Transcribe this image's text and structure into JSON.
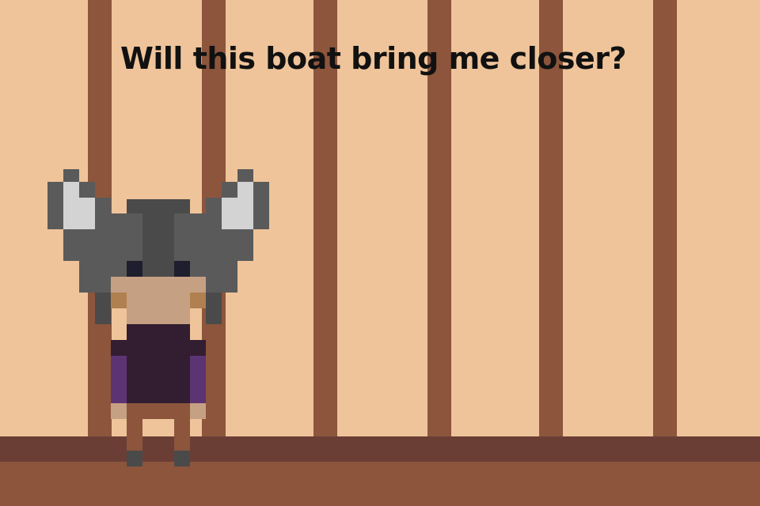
{
  "dialogue": {
    "text": "Will this boat bring me closer?"
  },
  "scene": {
    "background_color": "#efc49a",
    "bar_color": "#8c553c",
    "floor_color": "#8c553c",
    "floor_shadow_color": "#6a3e35"
  },
  "character": {
    "name": "viking-child",
    "helmet_color": "#5a5a5a",
    "horn_color": "#d3d3d3",
    "skin_color": "#c6a083",
    "tunic_color": "#331e31",
    "sleeve_color": "#5c3474"
  }
}
